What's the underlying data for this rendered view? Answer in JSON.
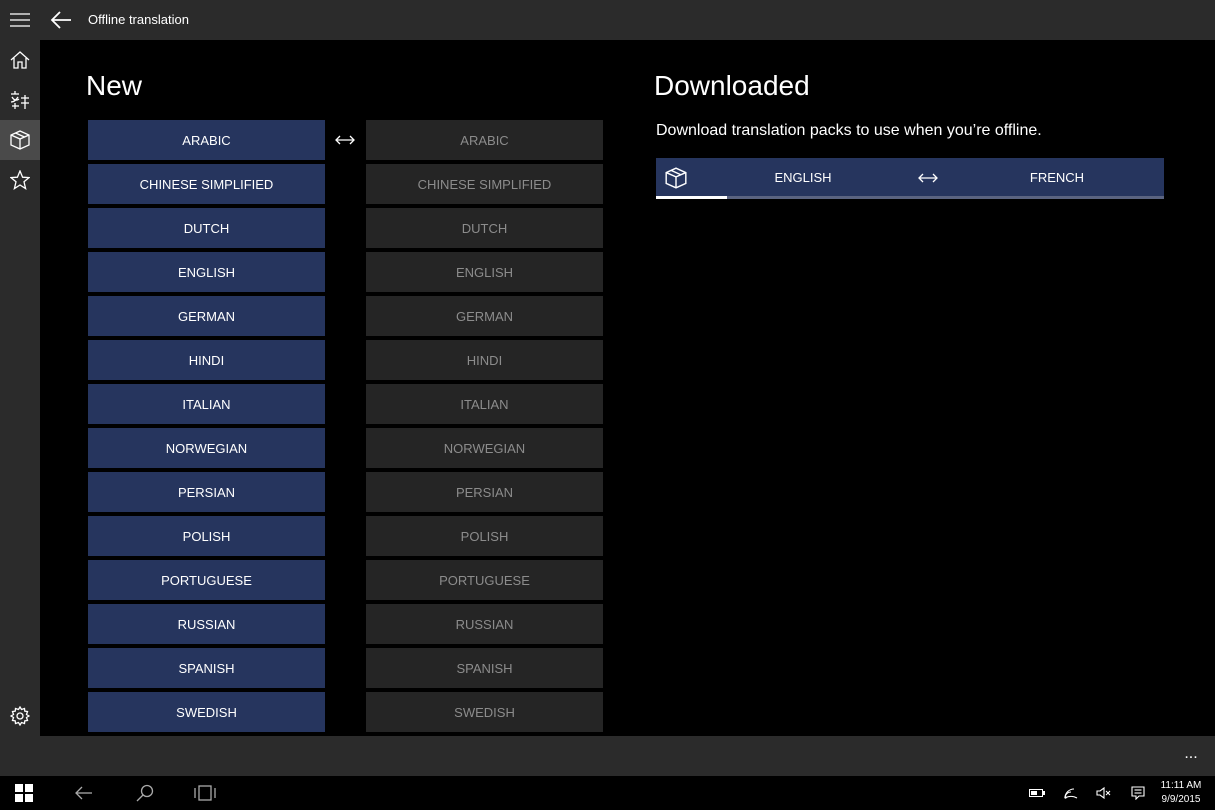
{
  "titlebar": {
    "title": "Offline translation"
  },
  "sidebar": {
    "items": [
      {
        "name": "home",
        "icon": "home-icon"
      },
      {
        "name": "translate",
        "icon": "translate-icon"
      },
      {
        "name": "offline-packs",
        "icon": "package-icon",
        "active": true
      },
      {
        "name": "favorites",
        "icon": "star-icon"
      }
    ],
    "settings_icon": "gear-icon"
  },
  "new_section": {
    "heading": "New"
  },
  "downloaded_section": {
    "heading": "Downloaded",
    "subtitle": "Download translation packs to use when you’re offline."
  },
  "languages_from": [
    "ARABIC",
    "CHINESE SIMPLIFIED",
    "DUTCH",
    "ENGLISH",
    "GERMAN",
    "HINDI",
    "ITALIAN",
    "NORWEGIAN",
    "PERSIAN",
    "POLISH",
    "PORTUGUESE",
    "RUSSIAN",
    "SPANISH",
    "SWEDISH"
  ],
  "languages_to": [
    "ARABIC",
    "CHINESE SIMPLIFIED",
    "DUTCH",
    "ENGLISH",
    "GERMAN",
    "HINDI",
    "ITALIAN",
    "NORWEGIAN",
    "PERSIAN",
    "POLISH",
    "PORTUGUESE",
    "RUSSIAN",
    "SPANISH",
    "SWEDISH"
  ],
  "downloaded_pack": {
    "from": "ENGLISH",
    "to": "FRENCH",
    "progress": 0.14
  },
  "appbar": {
    "more": "..."
  },
  "taskbar": {
    "time": "11:11 AM",
    "date": "9/9/2015"
  },
  "colors": {
    "accent": "#26355e",
    "chrome": "#2b2b2b",
    "disabled_tile": "#252525"
  }
}
